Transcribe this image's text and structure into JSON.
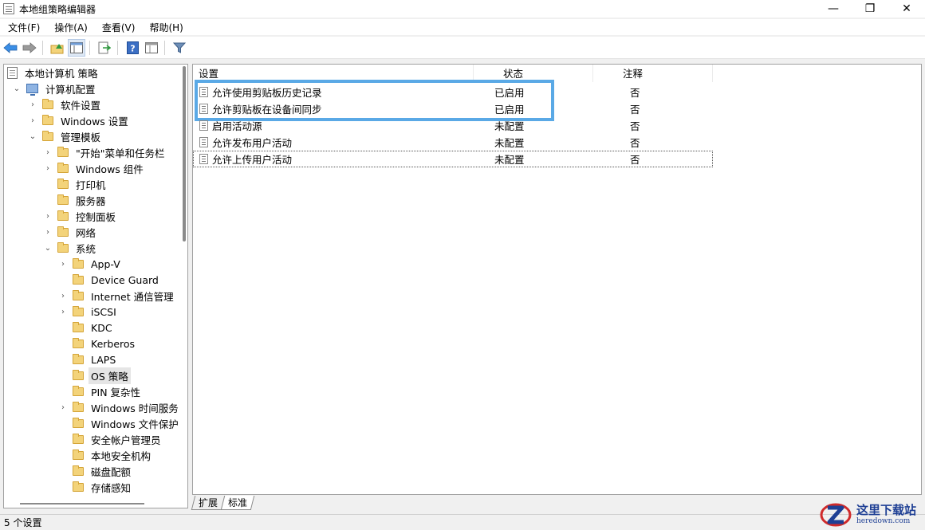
{
  "window": {
    "title": "本地组策略编辑器",
    "minimize": "—",
    "maximize": "❐",
    "close": "✕"
  },
  "menu": [
    "文件(F)",
    "操作(A)",
    "查看(V)",
    "帮助(H)"
  ],
  "toolbar": {
    "icons": [
      "back-icon",
      "forward-icon",
      "up-folder-icon",
      "show-hide-tree-icon",
      "export-list-icon",
      "help-icon",
      "properties-icon",
      "filter-icon"
    ]
  },
  "tree": [
    {
      "label": "本地计算机 策略",
      "level": 0,
      "icon": "doc",
      "twisty": ""
    },
    {
      "label": "计算机配置",
      "level": 1,
      "icon": "pc",
      "twisty": "open"
    },
    {
      "label": "软件设置",
      "level": 2,
      "icon": "folder",
      "twisty": "closed"
    },
    {
      "label": "Windows 设置",
      "level": 2,
      "icon": "folder",
      "twisty": "closed"
    },
    {
      "label": "管理模板",
      "level": 2,
      "icon": "folder",
      "twisty": "open"
    },
    {
      "label": "\"开始\"菜单和任务栏",
      "level": 3,
      "icon": "folder",
      "twisty": "closed"
    },
    {
      "label": "Windows 组件",
      "level": 3,
      "icon": "folder",
      "twisty": "closed"
    },
    {
      "label": "打印机",
      "level": 3,
      "icon": "folder",
      "twisty": ""
    },
    {
      "label": "服务器",
      "level": 3,
      "icon": "folder",
      "twisty": ""
    },
    {
      "label": "控制面板",
      "level": 3,
      "icon": "folder",
      "twisty": "closed"
    },
    {
      "label": "网络",
      "level": 3,
      "icon": "folder",
      "twisty": "closed"
    },
    {
      "label": "系统",
      "level": 3,
      "icon": "folder",
      "twisty": "open"
    },
    {
      "label": "App-V",
      "level": 4,
      "icon": "folder",
      "twisty": "closed"
    },
    {
      "label": "Device Guard",
      "level": 4,
      "icon": "folder",
      "twisty": ""
    },
    {
      "label": "Internet 通信管理",
      "level": 4,
      "icon": "folder",
      "twisty": "closed"
    },
    {
      "label": "iSCSI",
      "level": 4,
      "icon": "folder",
      "twisty": "closed"
    },
    {
      "label": "KDC",
      "level": 4,
      "icon": "folder",
      "twisty": ""
    },
    {
      "label": "Kerberos",
      "level": 4,
      "icon": "folder",
      "twisty": ""
    },
    {
      "label": "LAPS",
      "level": 4,
      "icon": "folder",
      "twisty": ""
    },
    {
      "label": "OS 策略",
      "level": 4,
      "icon": "folder",
      "twisty": "",
      "selected": true
    },
    {
      "label": "PIN 复杂性",
      "level": 4,
      "icon": "folder",
      "twisty": ""
    },
    {
      "label": "Windows 时间服务",
      "level": 4,
      "icon": "folder",
      "twisty": "closed"
    },
    {
      "label": "Windows 文件保护",
      "level": 4,
      "icon": "folder",
      "twisty": ""
    },
    {
      "label": "安全帐户管理员",
      "level": 4,
      "icon": "folder",
      "twisty": ""
    },
    {
      "label": "本地安全机构",
      "level": 4,
      "icon": "folder",
      "twisty": ""
    },
    {
      "label": "磁盘配额",
      "level": 4,
      "icon": "folder",
      "twisty": ""
    },
    {
      "label": "存储感知",
      "level": 4,
      "icon": "folder",
      "twisty": ""
    }
  ],
  "list": {
    "headers": [
      "设置",
      "状态",
      "注释"
    ],
    "rows": [
      {
        "name": "允许使用剪贴板历史记录",
        "state": "已启用",
        "comment": "否"
      },
      {
        "name": "允许剪贴板在设备间同步",
        "state": "已启用",
        "comment": "否"
      },
      {
        "name": "启用活动源",
        "state": "未配置",
        "comment": "否"
      },
      {
        "name": "允许发布用户活动",
        "state": "未配置",
        "comment": "否"
      },
      {
        "name": "允许上传用户活动",
        "state": "未配置",
        "comment": "否",
        "focused": true
      }
    ]
  },
  "tabs": [
    "扩展",
    "标准"
  ],
  "status": "5 个设置",
  "watermark": {
    "cn": "这里下载站",
    "en": "heredown.com"
  },
  "colors": {
    "highlight": "#5aa9e6",
    "folder": "#f3d37a",
    "brand": "#1e3f94"
  }
}
